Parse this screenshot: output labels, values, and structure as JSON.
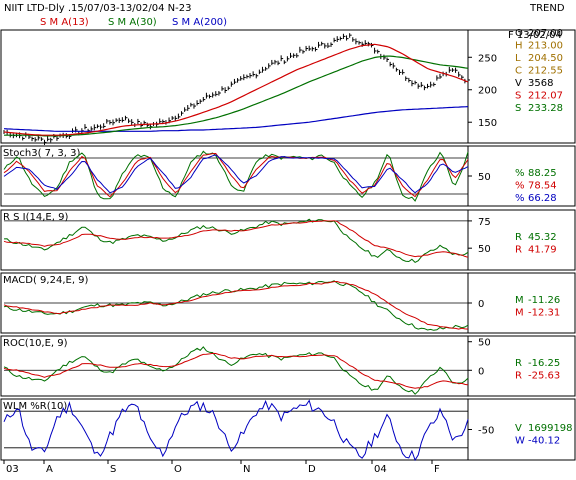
{
  "header": {
    "title": "NIIT LTD-Dly .15/07/03-13/02/04  N-23",
    "sma13_label": "S M A(13)",
    "sma30_label": "S M A(30)",
    "sma200_label": "S M A(200)",
    "trend_label": "TREND",
    "date_label": "F 13/02/04"
  },
  "price_panel_readout": [
    {
      "label": "O",
      "value": "207.00",
      "color": "#000000"
    },
    {
      "label": "H",
      "value": "213.00",
      "color": "#a07000"
    },
    {
      "label": "L",
      "value": "204.50",
      "color": "#a07000"
    },
    {
      "label": "C",
      "value": "212.55",
      "color": "#a07000"
    },
    {
      "label": "V",
      "value": "3568",
      "color": "#000000"
    },
    {
      "label": "S",
      "value": "212.07",
      "color": "#d00000"
    },
    {
      "label": "S",
      "value": "233.28",
      "color": "#007000"
    }
  ],
  "indicator_titles": {
    "stoch": "Stoch3( 7, 3, 3)",
    "rsi": "R S I(14,E, 9)",
    "macd": "MACD( 9,24,E, 9)",
    "roc": "ROC(10,E, 9)",
    "wlm": "WLM %R(10)"
  },
  "stoch_readout": [
    {
      "label": "%",
      "value": "88.25",
      "color": "#007000"
    },
    {
      "label": "%",
      "value": "78.54",
      "color": "#d00000"
    },
    {
      "label": "%",
      "value": "66.28",
      "color": "#0000c0"
    }
  ],
  "rsi_readout": [
    {
      "label": "R",
      "value": "45.32",
      "color": "#007000"
    },
    {
      "label": "R",
      "value": "41.79",
      "color": "#d00000"
    }
  ],
  "macd_readout": [
    {
      "label": "M",
      "value": "-11.26",
      "color": "#007000"
    },
    {
      "label": "M",
      "value": "-12.31",
      "color": "#d00000"
    }
  ],
  "roc_readout": [
    {
      "label": "R",
      "value": "-16.25",
      "color": "#007000"
    },
    {
      "label": "R",
      "value": "-25.63",
      "color": "#d00000"
    }
  ],
  "wlm_readout": [
    {
      "label": "V",
      "value": "1699198",
      "color": "#007000"
    },
    {
      "label": "W",
      "value": "-40.12",
      "color": "#0000c0"
    }
  ],
  "colors": {
    "sma13": "#d00000",
    "sma30": "#007000",
    "sma200": "#0000c0",
    "price": "#000000"
  },
  "chart_data": [
    {
      "type": "ohlc",
      "panel": "price",
      "x_ticks": [
        "03",
        "A",
        "S",
        "O",
        "N",
        "D",
        "04",
        "F"
      ],
      "y_ticks": [
        150,
        200,
        250
      ],
      "ylim": [
        118,
        292
      ],
      "series_close_key": [
        135,
        130,
        126,
        122,
        128,
        132,
        138,
        142,
        150,
        156,
        148,
        145,
        150,
        160,
        172,
        185,
        195,
        205,
        215,
        225,
        238,
        245,
        255,
        262,
        268,
        275,
        282,
        274,
        262,
        245,
        225,
        210,
        205,
        222,
        230,
        212
      ],
      "sma13_key": [
        135,
        133,
        131,
        130,
        130,
        131,
        133,
        136,
        140,
        144,
        146,
        147,
        148,
        152,
        158,
        165,
        172,
        180,
        190,
        200,
        210,
        220,
        230,
        238,
        246,
        254,
        262,
        268,
        270,
        266,
        256,
        244,
        232,
        226,
        220,
        212
      ],
      "sma30_key": [
        130,
        130,
        130,
        129,
        129,
        130,
        131,
        133,
        135,
        138,
        140,
        142,
        143,
        145,
        148,
        152,
        157,
        163,
        170,
        178,
        186,
        194,
        203,
        212,
        220,
        228,
        236,
        244,
        250,
        252,
        250,
        246,
        242,
        238,
        236,
        233
      ],
      "sma200_key": [
        140,
        139,
        138,
        137,
        136,
        136,
        136,
        136,
        136,
        136,
        136,
        136,
        137,
        137,
        138,
        138,
        139,
        140,
        141,
        142,
        144,
        146,
        148,
        150,
        153,
        156,
        159,
        162,
        165,
        167,
        169,
        170,
        171,
        172,
        173,
        174
      ]
    },
    {
      "type": "line",
      "panel": "stoch",
      "y_ticks": [
        50
      ],
      "ylim": [
        0,
        100
      ],
      "series": [
        {
          "name": "%",
          "values": [
            60,
            85,
            40,
            15,
            30,
            75,
            90,
            20,
            10,
            55,
            85,
            80,
            30,
            15,
            70,
            90,
            85,
            40,
            20,
            75,
            85,
            80,
            82,
            78,
            85,
            70,
            35,
            15,
            40,
            88,
            20,
            10,
            60,
            90,
            30,
            88
          ]
        },
        {
          "name": "%",
          "values": [
            55,
            75,
            55,
            25,
            25,
            60,
            85,
            35,
            15,
            40,
            75,
            82,
            45,
            20,
            55,
            85,
            88,
            55,
            28,
            60,
            82,
            82,
            80,
            80,
            82,
            75,
            45,
            22,
            35,
            75,
            35,
            15,
            45,
            82,
            45,
            78
          ]
        },
        {
          "name": "%",
          "values": [
            50,
            65,
            60,
            35,
            28,
            50,
            78,
            45,
            22,
            32,
            65,
            80,
            55,
            28,
            45,
            78,
            86,
            65,
            38,
            50,
            75,
            82,
            80,
            80,
            80,
            78,
            55,
            30,
            33,
            65,
            45,
            22,
            38,
            72,
            55,
            66
          ]
        }
      ]
    },
    {
      "type": "line",
      "panel": "rsi",
      "y_ticks": [
        50,
        75
      ],
      "ylim": [
        30,
        85
      ],
      "series": [
        {
          "name": "R",
          "values": [
            58,
            55,
            52,
            48,
            55,
            62,
            70,
            60,
            55,
            58,
            62,
            60,
            57,
            60,
            66,
            70,
            68,
            64,
            66,
            70,
            74,
            72,
            73,
            75,
            76,
            74,
            58,
            50,
            42,
            48,
            40,
            38,
            46,
            52,
            44,
            45
          ]
        },
        {
          "name": "R",
          "values": [
            56,
            55,
            54,
            52,
            53,
            57,
            63,
            62,
            59,
            58,
            60,
            60,
            59,
            60,
            62,
            66,
            67,
            66,
            66,
            68,
            71,
            72,
            73,
            74,
            75,
            75,
            68,
            60,
            52,
            50,
            46,
            42,
            44,
            47,
            45,
            42
          ]
        }
      ]
    },
    {
      "type": "line",
      "panel": "macd",
      "y_ticks": [
        0
      ],
      "ylim": [
        -14,
        14
      ],
      "series": [
        {
          "name": "M",
          "values": [
            -2,
            -3,
            -4,
            -5,
            -5,
            -4,
            -2,
            -1,
            -1,
            -1,
            0,
            0,
            -1,
            0,
            2,
            4,
            5,
            6,
            6,
            7,
            8,
            9,
            9,
            9,
            10,
            10,
            8,
            5,
            0,
            -4,
            -8,
            -11,
            -13,
            -12,
            -11,
            -11
          ]
        },
        {
          "name": "M",
          "values": [
            -1,
            -2,
            -3,
            -4,
            -5,
            -4,
            -3,
            -2,
            -1,
            -1,
            -1,
            0,
            -1,
            0,
            1,
            3,
            4,
            5,
            6,
            6,
            7,
            8,
            8,
            9,
            9,
            10,
            9,
            7,
            4,
            0,
            -4,
            -7,
            -10,
            -11,
            -12,
            -12
          ]
        }
      ]
    },
    {
      "type": "line",
      "panel": "roc",
      "y_ticks": [
        0,
        50
      ],
      "ylim": [
        -45,
        60
      ],
      "series": [
        {
          "name": "R",
          "values": [
            5,
            -10,
            -15,
            -20,
            0,
            15,
            25,
            5,
            -5,
            10,
            20,
            5,
            0,
            10,
            30,
            40,
            25,
            10,
            20,
            30,
            25,
            20,
            25,
            28,
            30,
            20,
            -10,
            -25,
            -35,
            -10,
            -30,
            -40,
            -15,
            5,
            -25,
            -16
          ]
        },
        {
          "name": "R",
          "values": [
            3,
            0,
            -6,
            -12,
            -8,
            2,
            12,
            10,
            5,
            6,
            12,
            10,
            6,
            8,
            18,
            28,
            30,
            22,
            20,
            24,
            26,
            24,
            24,
            25,
            27,
            25,
            10,
            -5,
            -18,
            -20,
            -25,
            -32,
            -28,
            -18,
            -22,
            -25
          ]
        }
      ]
    },
    {
      "type": "line",
      "panel": "wlm",
      "y_ticks": [
        -50
      ],
      "ylim": [
        -100,
        0
      ],
      "series": [
        {
          "name": "W",
          "values": [
            -40,
            -10,
            -80,
            -90,
            -30,
            -10,
            -50,
            -95,
            -60,
            -20,
            -10,
            -70,
            -90,
            -40,
            -15,
            -10,
            -30,
            -80,
            -60,
            -20,
            -10,
            -30,
            -15,
            -10,
            -20,
            -40,
            -80,
            -95,
            -60,
            -30,
            -85,
            -95,
            -50,
            -20,
            -70,
            -40
          ]
        }
      ]
    }
  ]
}
